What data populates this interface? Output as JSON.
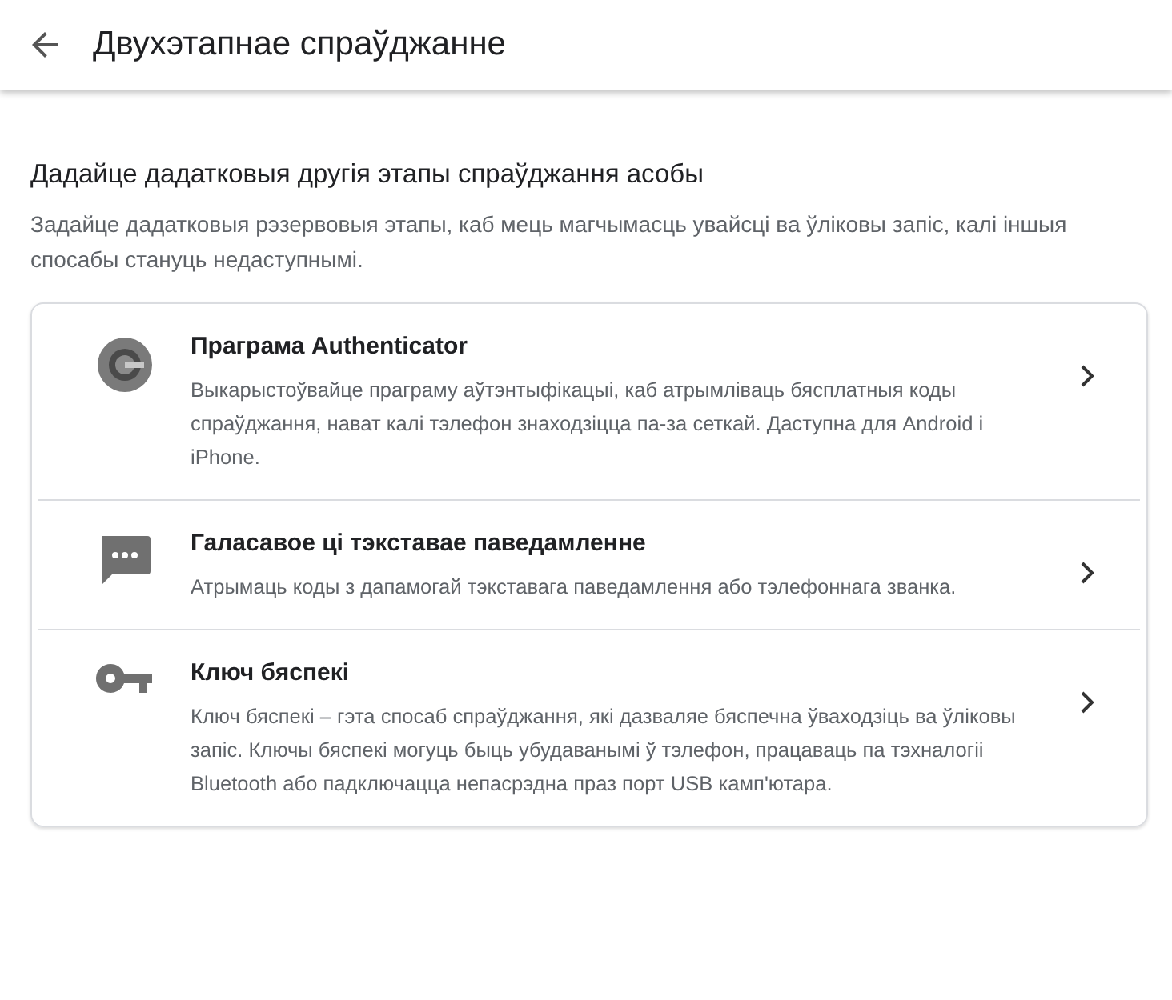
{
  "header": {
    "title": "Двухэтапнае спраўджанне"
  },
  "section": {
    "heading": "Дадайце дадатковыя другія этапы спраўджання асобы",
    "description": "Задайце дадатковыя рэзервовыя этапы, каб мець магчымасць увайсці ва ўліковы запіс, калі іншыя спосабы стануць недаступнымі."
  },
  "options": [
    {
      "kind": "authenticator",
      "title": "Праграма Authenticator",
      "description": "Выкарыстоўвайце праграму аўтэнтыфікацыі, каб атрымліваць бясплатныя коды спраўджання, нават калі тэлефон знаходзіцца па-за сеткай. Даступна для Android і iPhone."
    },
    {
      "kind": "message",
      "title": "Галасавое ці тэкставае паведамленне",
      "description": "Атрымаць коды з дапамогай тэкставага паведамлення або тэлефоннага званка."
    },
    {
      "kind": "key",
      "title": "Ключ бяспекі",
      "description": "Ключ бяспекі – гэта спосаб спраўджання, які дазваляе бяспечна ўваходзіць ва ўліковы запіс. Ключы бяспекі могуць быць убудаванымі ў тэлефон, працаваць па тэхналогіі Bluetooth або падключацца непасрэдна праз порт USB камп'ютара."
    }
  ]
}
